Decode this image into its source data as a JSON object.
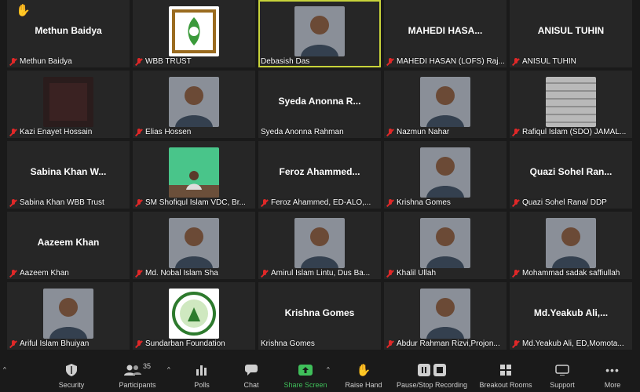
{
  "participants": [
    {
      "label": "Methun Baidya",
      "big_name": "Methun Baidya",
      "photo": null,
      "muted": true
    },
    {
      "label": "WBB TRUST",
      "big_name": null,
      "photo": "logo-wbb",
      "muted": true
    },
    {
      "label": "Debasish Das",
      "big_name": null,
      "photo": "person",
      "muted": false,
      "active": true
    },
    {
      "label": "MAHEDI HASAN (LOFS) Raj...",
      "big_name": "MAHEDI  HASA...",
      "photo": null,
      "muted": true
    },
    {
      "label": "ANISUL TUHIN",
      "big_name": "ANISUL TUHIN",
      "photo": null,
      "muted": true
    },
    {
      "label": "Kazi Enayet Hossain",
      "big_name": null,
      "photo": "dark",
      "muted": true
    },
    {
      "label": "Elias Hossen",
      "big_name": null,
      "photo": "person",
      "muted": true
    },
    {
      "label": "Syeda Anonna Rahman",
      "big_name": "Syeda Anonna R...",
      "photo": null,
      "muted": false
    },
    {
      "label": "Nazmun Nahar",
      "big_name": null,
      "photo": "person",
      "muted": true
    },
    {
      "label": "Rafiqul Islam (SDO) JAMAL...",
      "big_name": null,
      "photo": "shutter",
      "muted": true
    },
    {
      "label": "Sabina  Khan WBB Trust",
      "big_name": "Sabina  Khan W...",
      "photo": null,
      "muted": true
    },
    {
      "label": "SM Shofiqul Islam VDC, Br...",
      "big_name": null,
      "photo": "green-room",
      "muted": true
    },
    {
      "label": "Feroz Ahammed, ED-ALO,...",
      "big_name": "Feroz  Ahammed...",
      "photo": null,
      "muted": true
    },
    {
      "label": "Krishna Gomes",
      "big_name": null,
      "photo": "person",
      "muted": true
    },
    {
      "label": "Quazi Sohel Rana/ DDP",
      "big_name": "Quazi Sohel Ran...",
      "photo": null,
      "muted": true
    },
    {
      "label": "Aazeem Khan",
      "big_name": "Aazeem Khan",
      "photo": null,
      "muted": true
    },
    {
      "label": "Md. Nobal Islam Sha",
      "big_name": null,
      "photo": "person",
      "muted": true
    },
    {
      "label": "Amirul Islam Lintu,  Dus Ba...",
      "big_name": null,
      "photo": "person",
      "muted": true
    },
    {
      "label": "Khalil Ullah",
      "big_name": null,
      "photo": "person",
      "muted": true
    },
    {
      "label": "Mohammad sadak saffiullah",
      "big_name": null,
      "photo": "person",
      "muted": true
    },
    {
      "label": "Ariful Islam Bhuiyan",
      "big_name": null,
      "photo": "person",
      "muted": true
    },
    {
      "label": "Sundarban Foundation",
      "big_name": null,
      "photo": "logo-sf",
      "muted": true
    },
    {
      "label": "Krishna Gomes",
      "big_name": "Krishna Gomes",
      "photo": null,
      "muted": false
    },
    {
      "label": "Abdur Rahman Rizvi,Projon...",
      "big_name": null,
      "photo": "person",
      "muted": true
    },
    {
      "label": "Md.Yeakub Ali, ED,Momota...",
      "big_name": "Md.Yeakub  Ali,...",
      "photo": null,
      "muted": true
    }
  ],
  "raised_hand_icon": "raised-hand-icon",
  "toolbar": {
    "security": "Security",
    "participants": "Participants",
    "participant_count": "35",
    "polls": "Polls",
    "chat": "Chat",
    "share_screen": "Share Screen",
    "raise_hand": "Raise Hand",
    "record": "Pause/Stop Recording",
    "breakout": "Breakout Rooms",
    "support": "Support",
    "more": "More"
  },
  "colors": {
    "active_border": "#c8d33a",
    "mute": "#e02828",
    "share_green": "#3fbf5a"
  }
}
